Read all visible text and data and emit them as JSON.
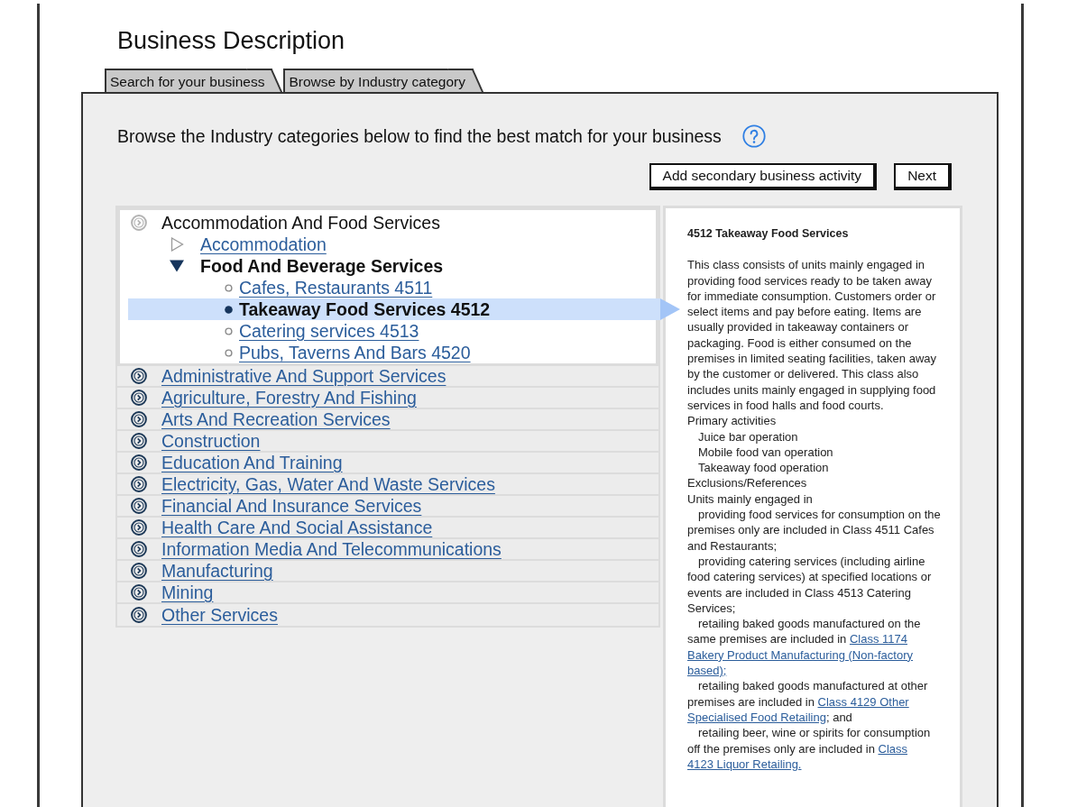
{
  "title": "Business Description",
  "tabs": [
    {
      "label": "Search for your business"
    },
    {
      "label": "Browse by Industry category"
    }
  ],
  "intro": "Browse the Industry categories below to find the best match for your business",
  "buttons": [
    "Add secondary business activity",
    "Next"
  ],
  "categories": [
    {
      "label": "Accommodation And Food Services",
      "expanded": true,
      "children": [
        {
          "label": "Accommodation",
          "expanded": false
        },
        {
          "label": "Food And Beverage Services",
          "expanded": true,
          "children": [
            {
              "label": "Cafes, Restaurants 4511",
              "selected": false
            },
            {
              "label": "Takeaway Food Services 4512",
              "selected": true
            },
            {
              "label": "Catering services 4513",
              "selected": false
            },
            {
              "label": "Pubs, Taverns And Bars 4520",
              "selected": false
            }
          ]
        }
      ]
    },
    {
      "label": "Administrative And Support Services",
      "expanded": false
    },
    {
      "label": "Agriculture, Forestry And Fishing",
      "expanded": false
    },
    {
      "label": "Arts And Recreation Services",
      "expanded": false
    },
    {
      "label": "Construction",
      "expanded": false
    },
    {
      "label": "Education And Training",
      "expanded": false
    },
    {
      "label": "Electricity, Gas, Water And Waste Services",
      "expanded": false
    },
    {
      "label": "Financial And Insurance Services",
      "expanded": false
    },
    {
      "label": "Health Care And Social Assistance",
      "expanded": false
    },
    {
      "label": "Information Media And Telecommunications",
      "expanded": false
    },
    {
      "label": "Manufacturing",
      "expanded": false
    },
    {
      "label": "Mining",
      "expanded": false
    },
    {
      "label": "Other Services",
      "expanded": false
    }
  ],
  "description": {
    "title": "4512 Takeaway Food Services",
    "blocks": [
      {
        "kind": "text",
        "parts": [
          {
            "kind": "text",
            "text": "This class consists of units mainly engaged in providing food services ready to be taken away for immediate consumption. Customers order or select items and pay before eating. Items are usually provided in takeaway containers or packaging. Food is either consumed on the premises in limited seating facilities, taken away by the customer or delivered. This class also includes units mainly engaged in supplying food services in food halls and food courts."
          }
        ]
      },
      {
        "kind": "text",
        "parts": [
          {
            "kind": "text",
            "text": "Primary activities"
          }
        ]
      },
      {
        "kind": "indented",
        "parts": [
          {
            "kind": "text",
            "text": "Juice bar operation"
          }
        ]
      },
      {
        "kind": "indented",
        "parts": [
          {
            "kind": "text",
            "text": "Mobile food van operation"
          }
        ]
      },
      {
        "kind": "indented",
        "parts": [
          {
            "kind": "text",
            "text": "Takeaway food operation"
          }
        ]
      },
      {
        "kind": "text",
        "parts": [
          {
            "kind": "text",
            "text": "Exclusions/References"
          }
        ]
      },
      {
        "kind": "text",
        "parts": [
          {
            "kind": "text",
            "text": "Units mainly engaged in"
          }
        ]
      },
      {
        "kind": "indented",
        "parts": [
          {
            "kind": "text",
            "text": "providing food services for consumption on the premises only are included in Class 4511 Cafes and Restaurants;"
          }
        ]
      },
      {
        "kind": "indented",
        "parts": [
          {
            "kind": "text",
            "text": "providing catering services (including airline food catering services) at specified locations or events are included in Class 4513 Catering Services;"
          }
        ]
      },
      {
        "kind": "indented",
        "parts": [
          {
            "kind": "text",
            "text": "retailing baked goods manufactured on the same premises are included in "
          },
          {
            "kind": "link",
            "text": "Class 1174"
          },
          {
            "kind": "link",
            "text": "Bakery Product Manufacturing (Non-factory"
          },
          {
            "kind": "link",
            "text": "based);"
          }
        ]
      },
      {
        "kind": "indented",
        "parts": [
          {
            "kind": "text",
            "text": "retailing baked goods manufactured at other premises are included in "
          },
          {
            "kind": "link",
            "text": "Class 4129 Other"
          },
          {
            "kind": "link",
            "text": "Specialised Food Retailing"
          },
          {
            "kind": "text",
            "text": "; and"
          }
        ]
      },
      {
        "kind": "indented",
        "parts": [
          {
            "kind": "text",
            "text": "retailing beer, wine or spirits for consumption off the premises only are included in "
          },
          {
            "kind": "link",
            "text": "Class"
          },
          {
            "kind": "link",
            "text": "4123 Liquor Retailing."
          }
        ]
      }
    ]
  }
}
